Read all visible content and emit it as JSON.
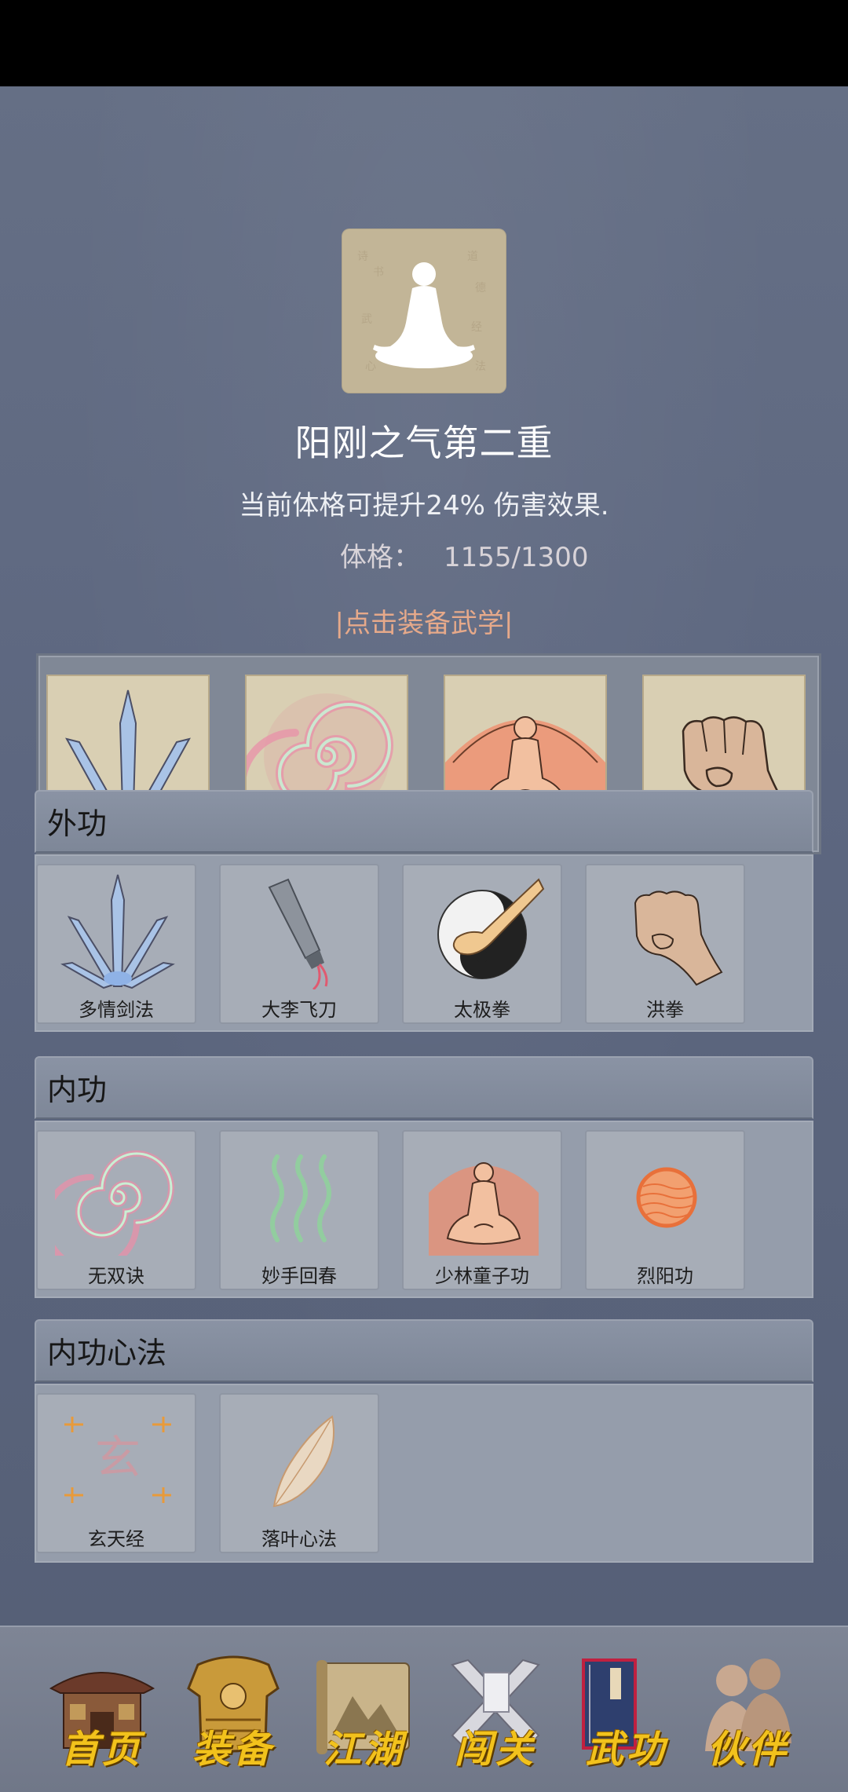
{
  "header": {
    "title": "阳刚之气第二重",
    "description": "当前体格可提升24% 伤害效果.",
    "stat_label": "体格：",
    "stat_value": "1155/1300",
    "equip_hint": "|点击装备武学|"
  },
  "equipped_slots": [
    {
      "icon": "sword-fan-icon"
    },
    {
      "icon": "spiral-qi-icon"
    },
    {
      "icon": "meditating-monk-icon"
    },
    {
      "icon": "fist-icon"
    }
  ],
  "sections": [
    {
      "title": "外功",
      "items": [
        {
          "label": "多情剑法",
          "icon": "sword-fan-icon"
        },
        {
          "label": "大李飞刀",
          "icon": "flying-knife-icon"
        },
        {
          "label": "太极拳",
          "icon": "taiji-icon"
        },
        {
          "label": "洪拳",
          "icon": "fist-icon"
        }
      ]
    },
    {
      "title": "内功",
      "items": [
        {
          "label": "无双诀",
          "icon": "spiral-qi-icon"
        },
        {
          "label": "妙手回春",
          "icon": "healing-waves-icon"
        },
        {
          "label": "少林童子功",
          "icon": "meditating-monk-icon"
        },
        {
          "label": "烈阳功",
          "icon": "sun-orb-icon"
        }
      ]
    },
    {
      "title": "内功心法",
      "items": [
        {
          "label": "玄天经",
          "icon": "xuan-scripture-icon",
          "glyph": "玄"
        },
        {
          "label": "落叶心法",
          "icon": "falling-leaf-icon"
        }
      ]
    }
  ],
  "nav": {
    "items": [
      {
        "label": "首页",
        "icon": "home-pavilion-icon"
      },
      {
        "label": "装备",
        "icon": "armor-icon"
      },
      {
        "label": "江湖",
        "icon": "scroll-map-icon"
      },
      {
        "label": "闯关",
        "icon": "crossed-swords-icon"
      },
      {
        "label": "武功",
        "icon": "martial-book-icon"
      },
      {
        "label": "伙伴",
        "icon": "companions-icon"
      }
    ]
  },
  "colors": {
    "background": "#5f6a80",
    "title_text": "#ffffff",
    "hint_text": "#e6a98a",
    "nav_text": "#f2c21c"
  }
}
